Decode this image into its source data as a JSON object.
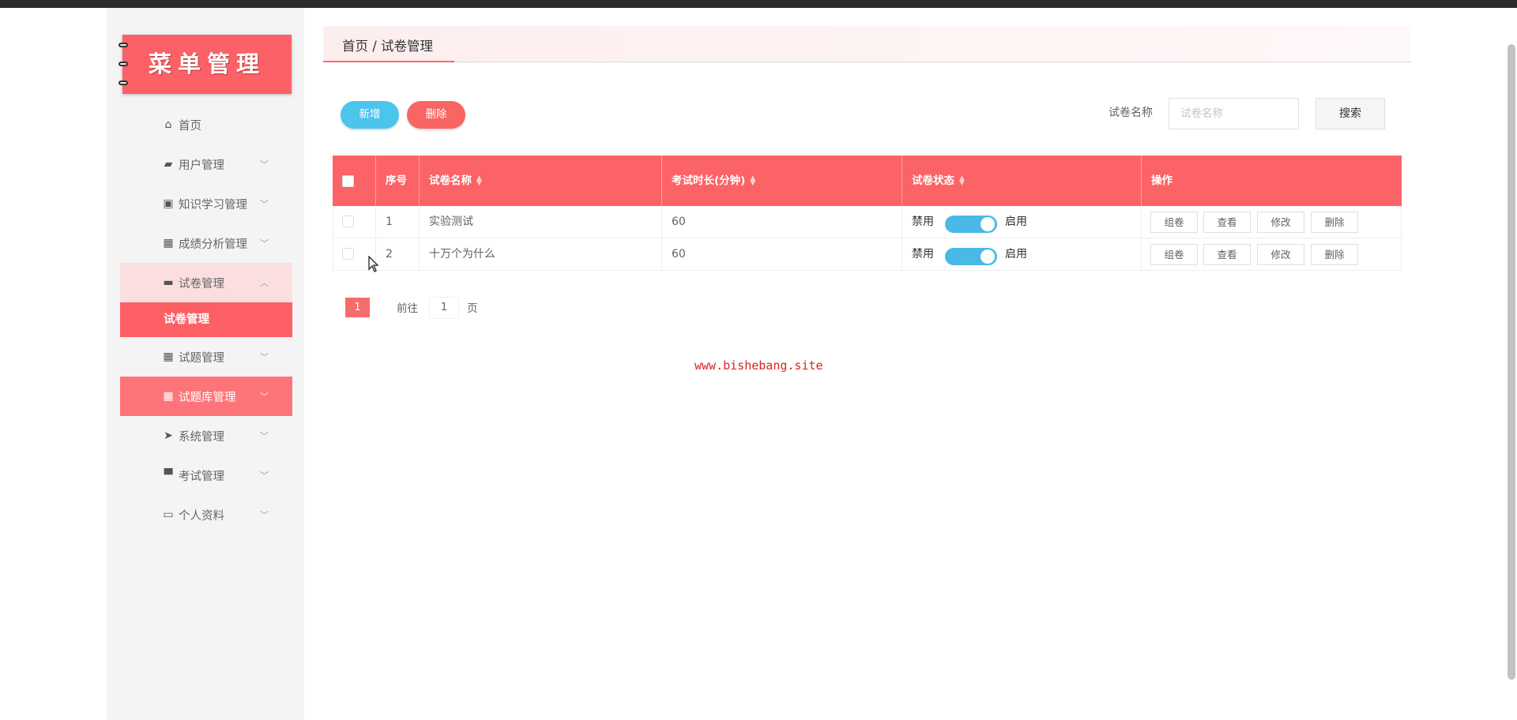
{
  "logo": {
    "title": "菜单管理"
  },
  "sidebar": {
    "items": [
      {
        "label": "首页",
        "icon": "home-icon",
        "glyph": "⌂",
        "chevron": ""
      },
      {
        "label": "用户管理",
        "icon": "user-card-icon",
        "glyph": "▰",
        "chevron": "﹀"
      },
      {
        "label": "知识学习管理",
        "icon": "clipboard-icon",
        "glyph": "▣",
        "chevron": "﹀"
      },
      {
        "label": "成绩分析管理",
        "icon": "grid-icon",
        "glyph": "▦",
        "chevron": "﹀"
      },
      {
        "label": "试卷管理",
        "icon": "inbox-icon",
        "glyph": "▬",
        "chevron": "︿"
      },
      {
        "label": "试题管理",
        "icon": "grid-icon",
        "glyph": "▦",
        "chevron": "﹀"
      },
      {
        "label": "试题库管理",
        "icon": "grid-icon",
        "glyph": "▦",
        "chevron": "﹀"
      },
      {
        "label": "系统管理",
        "icon": "send-icon",
        "glyph": "➤",
        "chevron": "﹀"
      },
      {
        "label": "考试管理",
        "icon": "monitor-icon",
        "glyph": "▀",
        "chevron": "﹀"
      },
      {
        "label": "个人资料",
        "icon": "window-icon",
        "glyph": "▭",
        "chevron": "﹀"
      }
    ],
    "submenu": {
      "label": "试卷管理"
    }
  },
  "breadcrumb": {
    "text": "首页 / 试卷管理"
  },
  "toolbar": {
    "add_label": "新增",
    "delete_label": "删除",
    "search_label": "试卷名称",
    "search_placeholder": "试卷名称",
    "search_value": "",
    "search_button": "搜索"
  },
  "table": {
    "headers": {
      "index": "序号",
      "name": "试卷名称",
      "duration": "考试时长(分钟)",
      "status": "试卷状态",
      "ops": "操作"
    },
    "rows": [
      {
        "index": "1",
        "name": "实验测试",
        "duration": "60",
        "off": "禁用",
        "on": "启用"
      },
      {
        "index": "2",
        "name": "十万个为什么",
        "duration": "60",
        "off": "禁用",
        "on": "启用"
      }
    ],
    "row_buttons": [
      "组卷",
      "查看",
      "修改",
      "删除"
    ]
  },
  "pagination": {
    "current": "1",
    "goto_prefix": "前往",
    "goto_value": "1",
    "goto_suffix": "页"
  },
  "watermark": "www.bishebang.site",
  "colors": {
    "accent": "#f56c6c",
    "header": "#fc6366",
    "add": "#4cc5ec",
    "delete": "#f96563",
    "switch": "#4ab9e6"
  }
}
